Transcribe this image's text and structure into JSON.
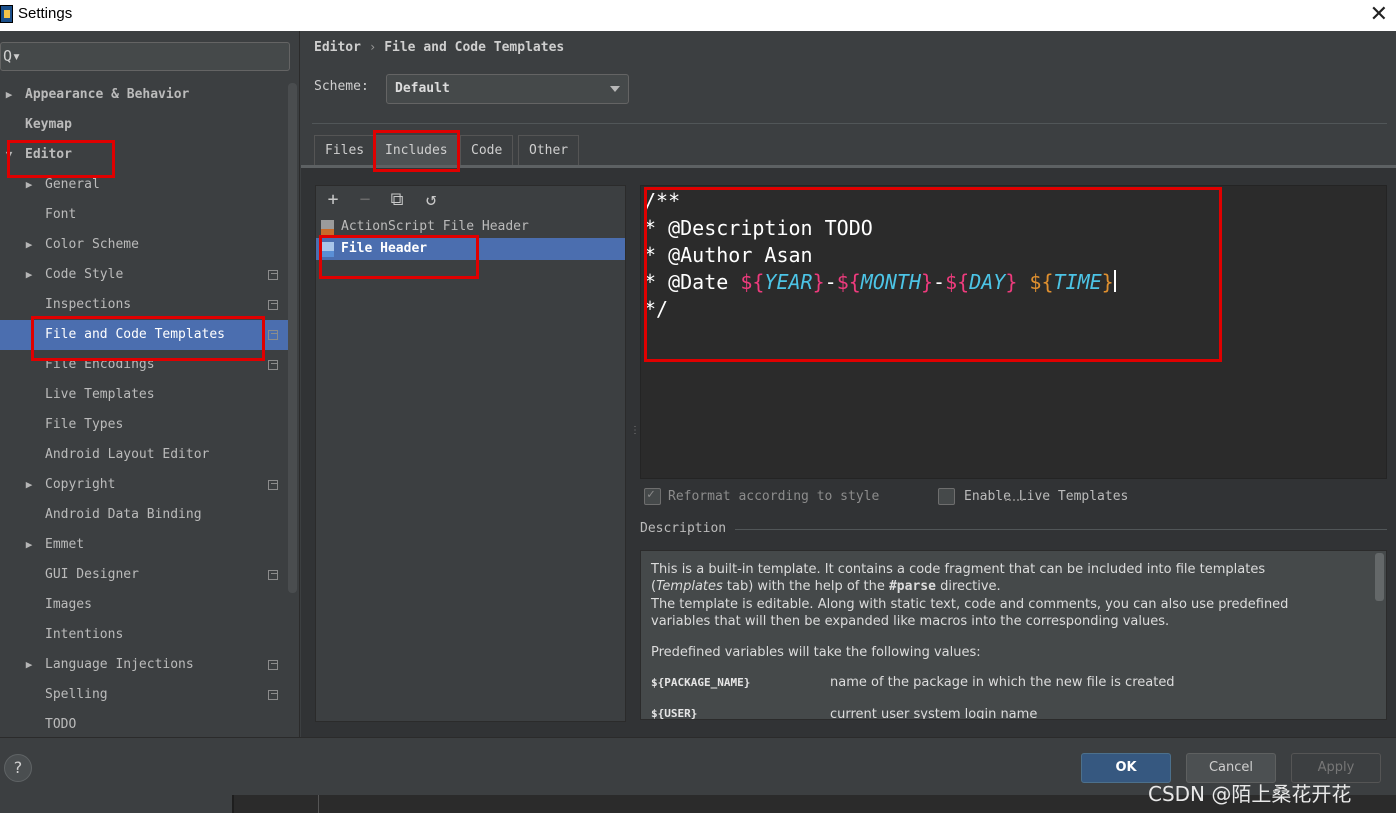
{
  "window": {
    "title": "Settings",
    "close_glyph": "✕"
  },
  "search": {
    "icon": "search-icon",
    "glyph": "Q▾"
  },
  "sidebar": {
    "items": [
      {
        "label": "Appearance & Behavior",
        "arrow": "▶"
      },
      {
        "label": "Keymap",
        "arrow": ""
      },
      {
        "label": "Editor",
        "arrow": "▼"
      },
      {
        "label": "General",
        "arrow": "▶"
      },
      {
        "label": "Font",
        "arrow": ""
      },
      {
        "label": "Color Scheme",
        "arrow": "▶"
      },
      {
        "label": "Code Style",
        "arrow": "▶"
      },
      {
        "label": "Inspections",
        "arrow": ""
      },
      {
        "label": "File and Code Templates",
        "arrow": ""
      },
      {
        "label": "File Encodings",
        "arrow": ""
      },
      {
        "label": "Live Templates",
        "arrow": ""
      },
      {
        "label": "File Types",
        "arrow": ""
      },
      {
        "label": "Android Layout Editor",
        "arrow": ""
      },
      {
        "label": "Copyright",
        "arrow": "▶"
      },
      {
        "label": "Android Data Binding",
        "arrow": ""
      },
      {
        "label": "Emmet",
        "arrow": "▶"
      },
      {
        "label": "GUI Designer",
        "arrow": ""
      },
      {
        "label": "Images",
        "arrow": ""
      },
      {
        "label": "Intentions",
        "arrow": ""
      },
      {
        "label": "Language Injections",
        "arrow": "▶"
      },
      {
        "label": "Spelling",
        "arrow": ""
      },
      {
        "label": "TODO",
        "arrow": ""
      }
    ]
  },
  "breadcrumb": {
    "parent": "Editor",
    "separator": "›",
    "current": "File and Code Templates"
  },
  "scheme": {
    "label": "Scheme:",
    "value": "Default"
  },
  "tabs": [
    {
      "label": "Files"
    },
    {
      "label": "Includes"
    },
    {
      "label": "Code"
    },
    {
      "label": "Other"
    }
  ],
  "toolbar": {
    "add": "+",
    "remove": "−",
    "copy": "⧉",
    "reset": "↺"
  },
  "templates": [
    {
      "label": "ActionScript File Header"
    },
    {
      "label": "File Header"
    }
  ],
  "editor": {
    "line1": "/**",
    "line2": "* @Description TODO",
    "line3": "* @Author Asan",
    "line4_prefix": "* @Date ",
    "var_open": "${",
    "var_close": "}",
    "dash": "-",
    "space": " ",
    "var_year": "YEAR",
    "var_month": "MONTH",
    "var_day": "DAY",
    "var_time": "TIME",
    "line5": "*/"
  },
  "options": {
    "reformat": "Reformat according to style",
    "live_templates": "Enable Live Templates"
  },
  "description": {
    "title": "Description",
    "p1a": "This is a built-in template. It contains a code fragment that can be included into file templates",
    "p1b_pre": "(",
    "p1b_em": "Templates",
    "p1b_mid": " tab) with the help of the ",
    "p1b_code": "#parse",
    "p1b_post": " directive.",
    "p2a": "The template is editable. Along with static text, code and comments, you can also use predefined",
    "p2b": "variables that will then be expanded like macros into the corresponding values.",
    "p3": "Predefined variables will take the following values:",
    "vars": [
      {
        "name": "${PACKAGE_NAME}",
        "desc": "name of the package in which the new file is created"
      },
      {
        "name": "${USER}",
        "desc": "current user system login name"
      }
    ]
  },
  "buttons": {
    "help": "?",
    "ok": "OK",
    "cancel": "Cancel",
    "apply": "Apply"
  },
  "watermark": "CSDN @陌上桑花开花",
  "colors": {
    "selection": "#4b6eaf",
    "highlight": "#e00000",
    "var_pink": "#ee3b7d",
    "var_cyan": "#4cc4e6",
    "var_orange": "#e0902f"
  }
}
